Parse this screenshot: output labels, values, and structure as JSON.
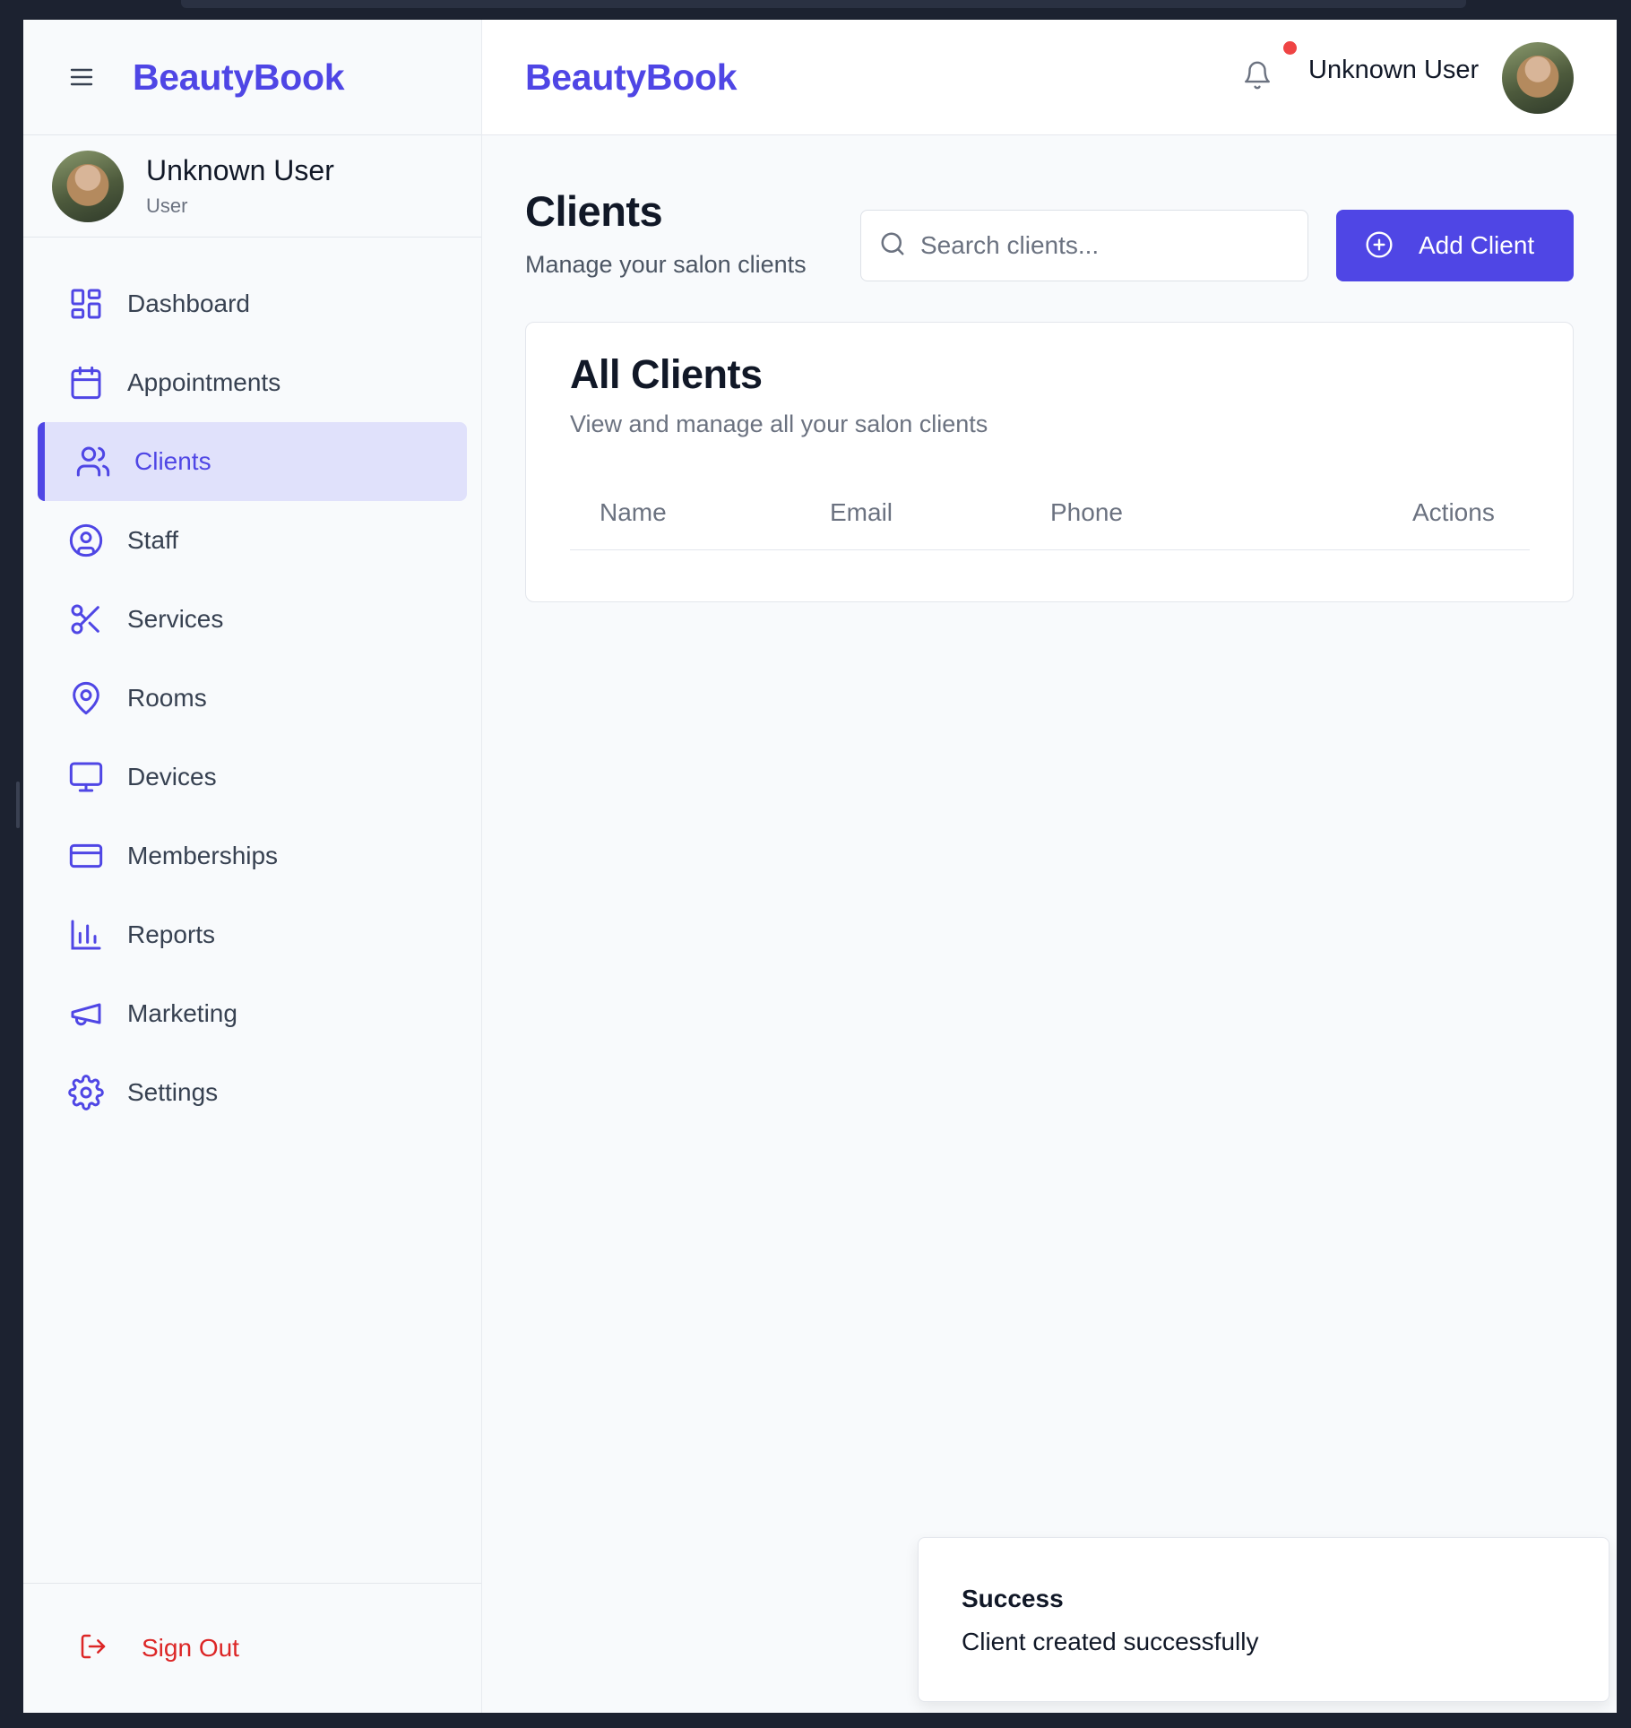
{
  "brand": "BeautyBook",
  "user": {
    "name": "Unknown User",
    "role": "User"
  },
  "sidebar": {
    "items": [
      {
        "label": "Dashboard",
        "icon": "dashboard-icon"
      },
      {
        "label": "Appointments",
        "icon": "calendar-icon"
      },
      {
        "label": "Clients",
        "icon": "users-icon",
        "active": true
      },
      {
        "label": "Staff",
        "icon": "user-circle-icon"
      },
      {
        "label": "Services",
        "icon": "scissors-icon"
      },
      {
        "label": "Rooms",
        "icon": "map-pin-icon"
      },
      {
        "label": "Devices",
        "icon": "monitor-icon"
      },
      {
        "label": "Memberships",
        "icon": "credit-card-icon"
      },
      {
        "label": "Reports",
        "icon": "bar-chart-icon"
      },
      {
        "label": "Marketing",
        "icon": "megaphone-icon"
      },
      {
        "label": "Settings",
        "icon": "gear-icon"
      }
    ],
    "sign_out": "Sign Out"
  },
  "header": {
    "brand": "BeautyBook",
    "user_name": "Unknown User",
    "has_notification": true
  },
  "page": {
    "title": "Clients",
    "subtitle": "Manage your salon clients",
    "search_placeholder": "Search clients...",
    "add_button": "Add Client"
  },
  "card": {
    "title": "All Clients",
    "subtitle": "View and manage all your salon clients",
    "columns": [
      "Name",
      "Email",
      "Phone",
      "Actions"
    ],
    "rows": []
  },
  "toast": {
    "title": "Success",
    "description": "Client created successfully"
  },
  "colors": {
    "accent": "#4f46e5",
    "active_bg": "#e0e1fb",
    "danger": "#dc2626",
    "notification": "#ef4444"
  }
}
